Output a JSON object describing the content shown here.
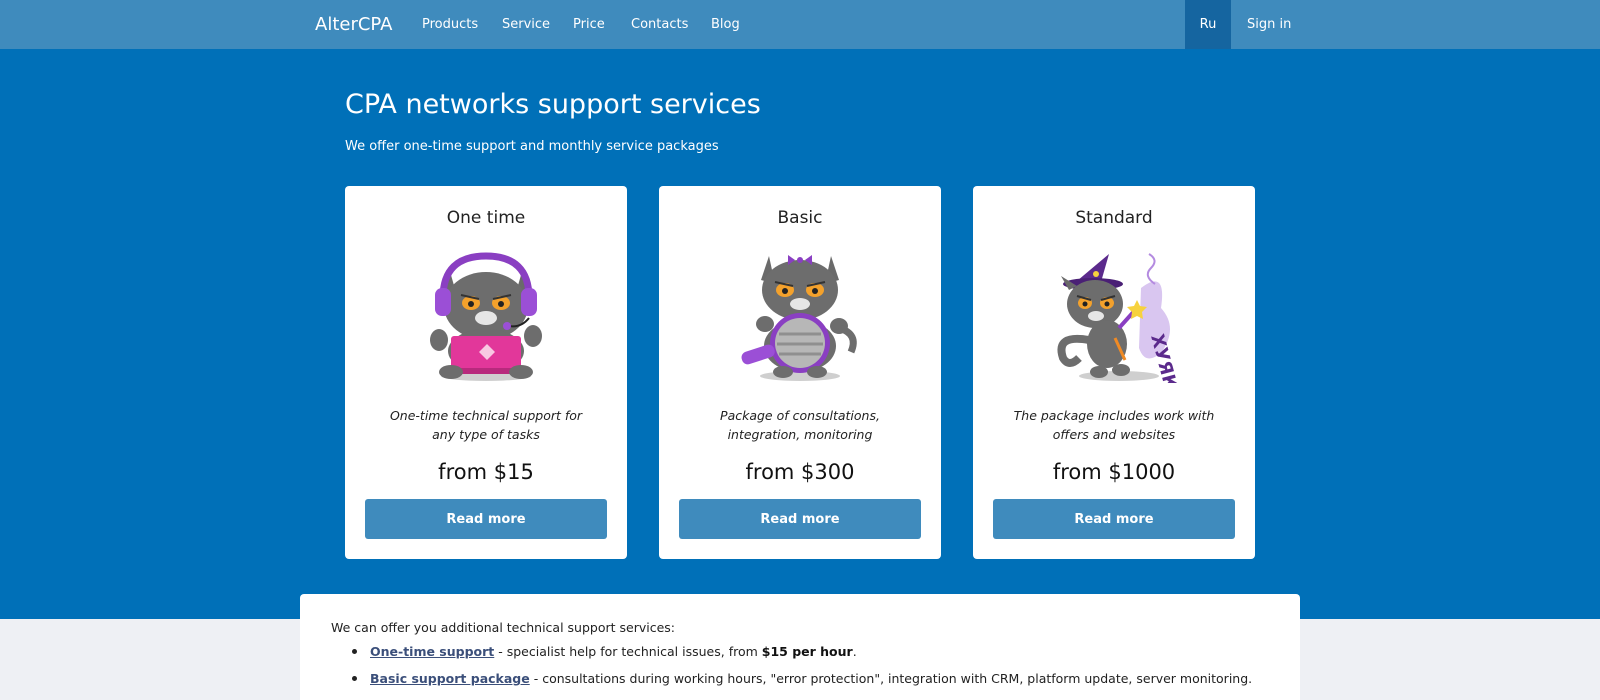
{
  "navbar": {
    "brand": "AlterCPA",
    "links": [
      "Products",
      "Service",
      "Price",
      "Contacts",
      "Blog"
    ],
    "lang": "Ru",
    "signin": "Sign in"
  },
  "hero": {
    "title": "CPA networks support services",
    "subtitle": "We offer one-time support and monthly service packages"
  },
  "cards": [
    {
      "title": "One time",
      "image": "cat-with-headphones-and-laptop",
      "desc_line1": "One-time technical support for",
      "desc_line2": "any type of tasks",
      "price": "from $15",
      "button": "Read more"
    },
    {
      "title": "Basic",
      "image": "cat-holding-shield",
      "desc_line1": "Package of consultations,",
      "desc_line2": "integration, monitoring",
      "price": "from $300",
      "button": "Read more"
    },
    {
      "title": "Standard",
      "image": "wizard-cat-with-wand",
      "desc_line1": "The package includes work with",
      "desc_line2": "offers and websites",
      "price": "from $1000",
      "button": "Read more"
    }
  ],
  "services": {
    "intro": "We can offer you additional technical support services:",
    "items": [
      {
        "link": "One-time support",
        "text": " - specialist help for technical issues, from ",
        "bold": "$15 per hour",
        "tail": "."
      },
      {
        "link": "Basic support package",
        "text": " - consultations during working hours, \"error protection\", integration with CRM, platform update, server monitoring.",
        "bold": "",
        "tail": ""
      }
    ]
  },
  "colors": {
    "navbar": "#3f8bbd",
    "hero": "#0070b8",
    "lang_active": "#1565a0",
    "button": "#3f8bbd",
    "page_bg": "#eef0f4"
  }
}
